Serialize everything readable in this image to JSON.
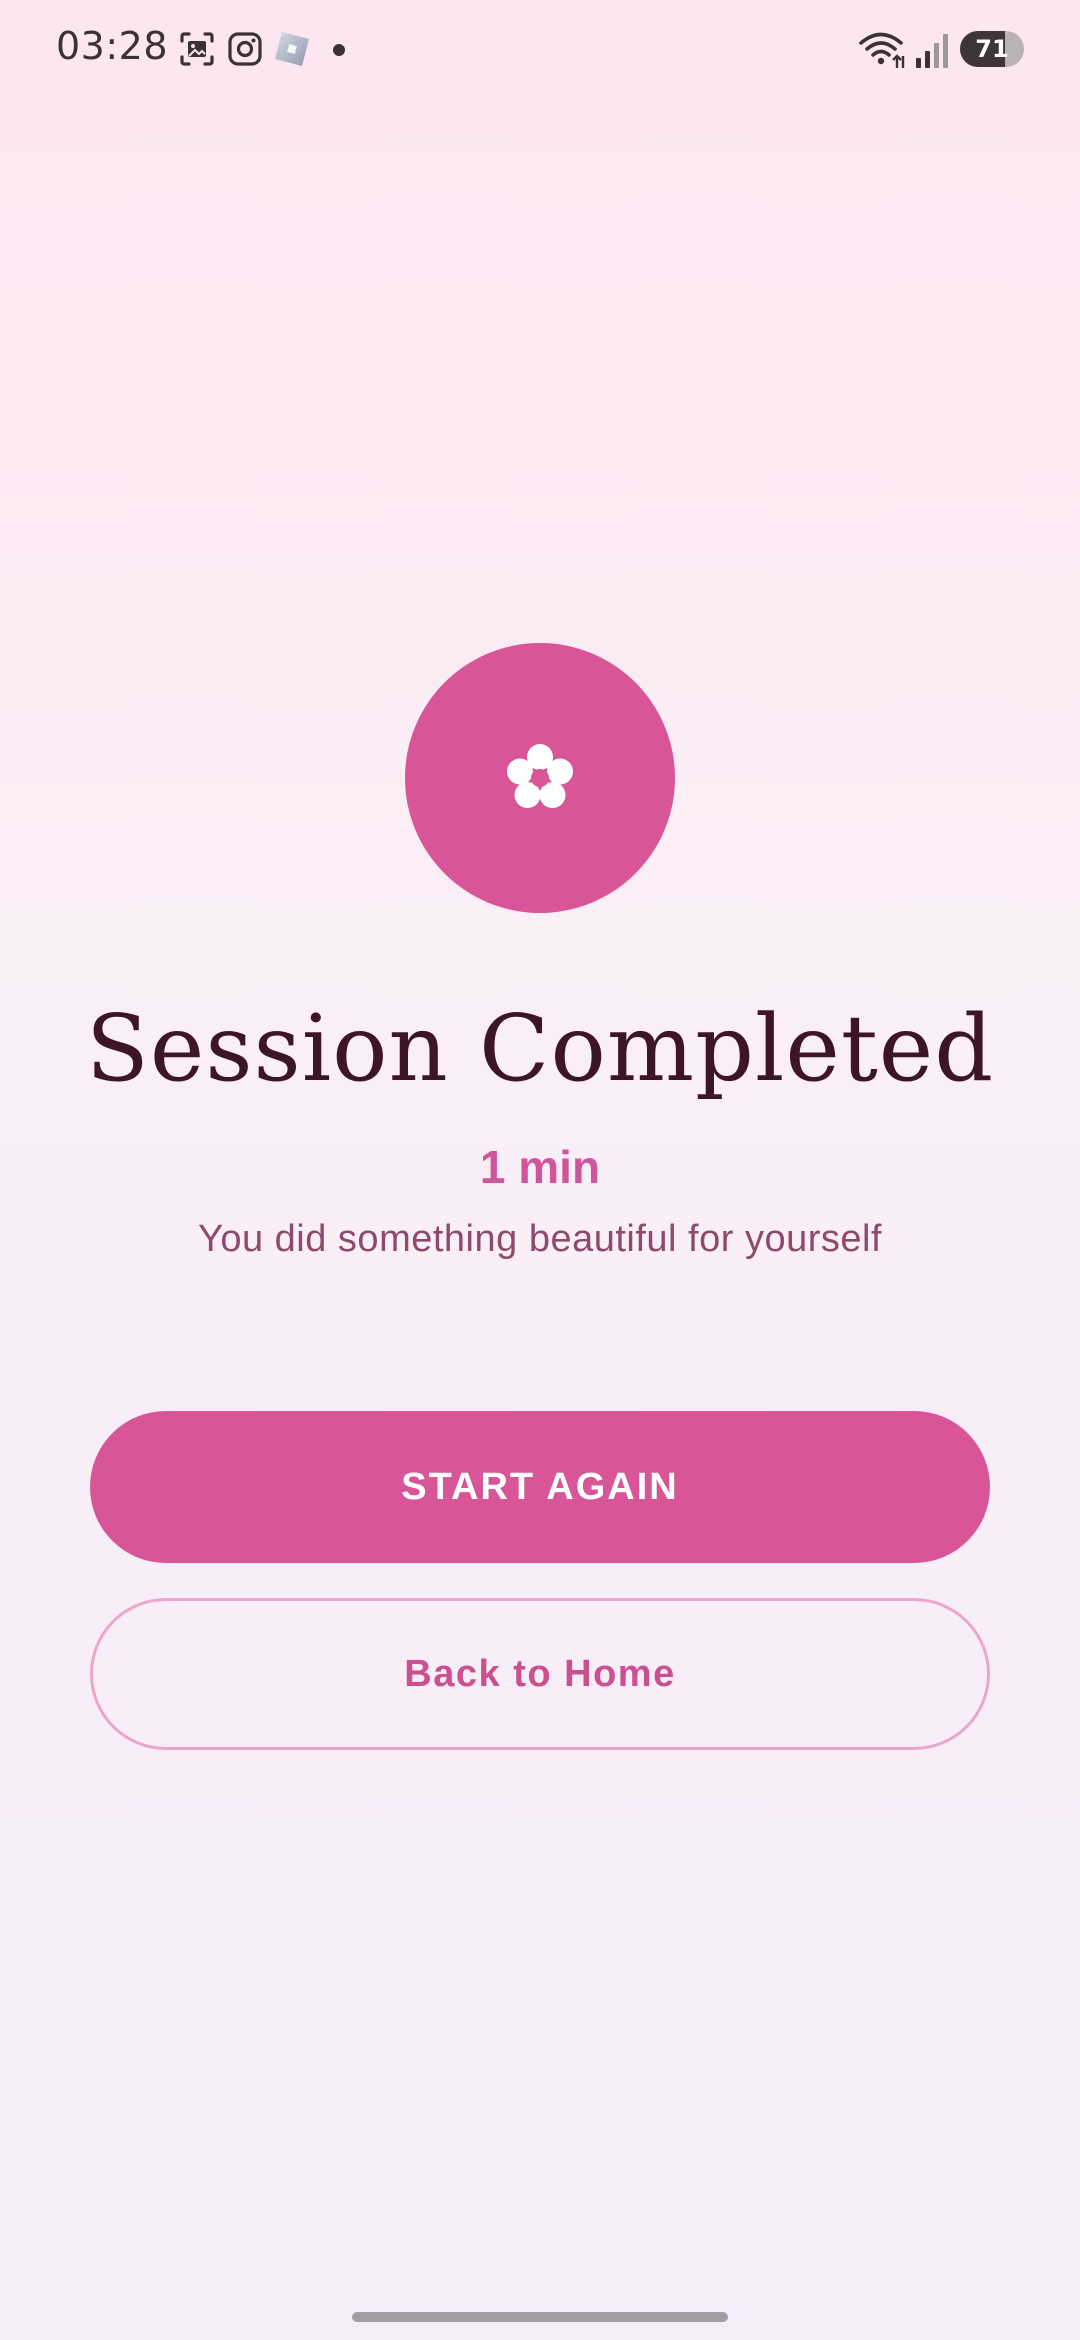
{
  "status_bar": {
    "time": "03:28",
    "battery_level": "71",
    "battery_percent": 71,
    "icons": [
      "screenshot-icon",
      "instagram-icon",
      "roblox-icon",
      "notification-dot",
      "wifi-icon",
      "signal-icon",
      "battery-icon"
    ]
  },
  "main": {
    "badge_icon": "flower-icon",
    "title": "Session Completed",
    "duration": "1 min",
    "subtitle": "You did something beautiful for yourself"
  },
  "actions": {
    "start_again_label": "START AGAIN",
    "back_home_label": "Back to Home"
  },
  "colors": {
    "accent": "#d85597",
    "title": "#3d1528",
    "subtitle": "#8e4a6d",
    "outline": "#eaa6cb"
  }
}
